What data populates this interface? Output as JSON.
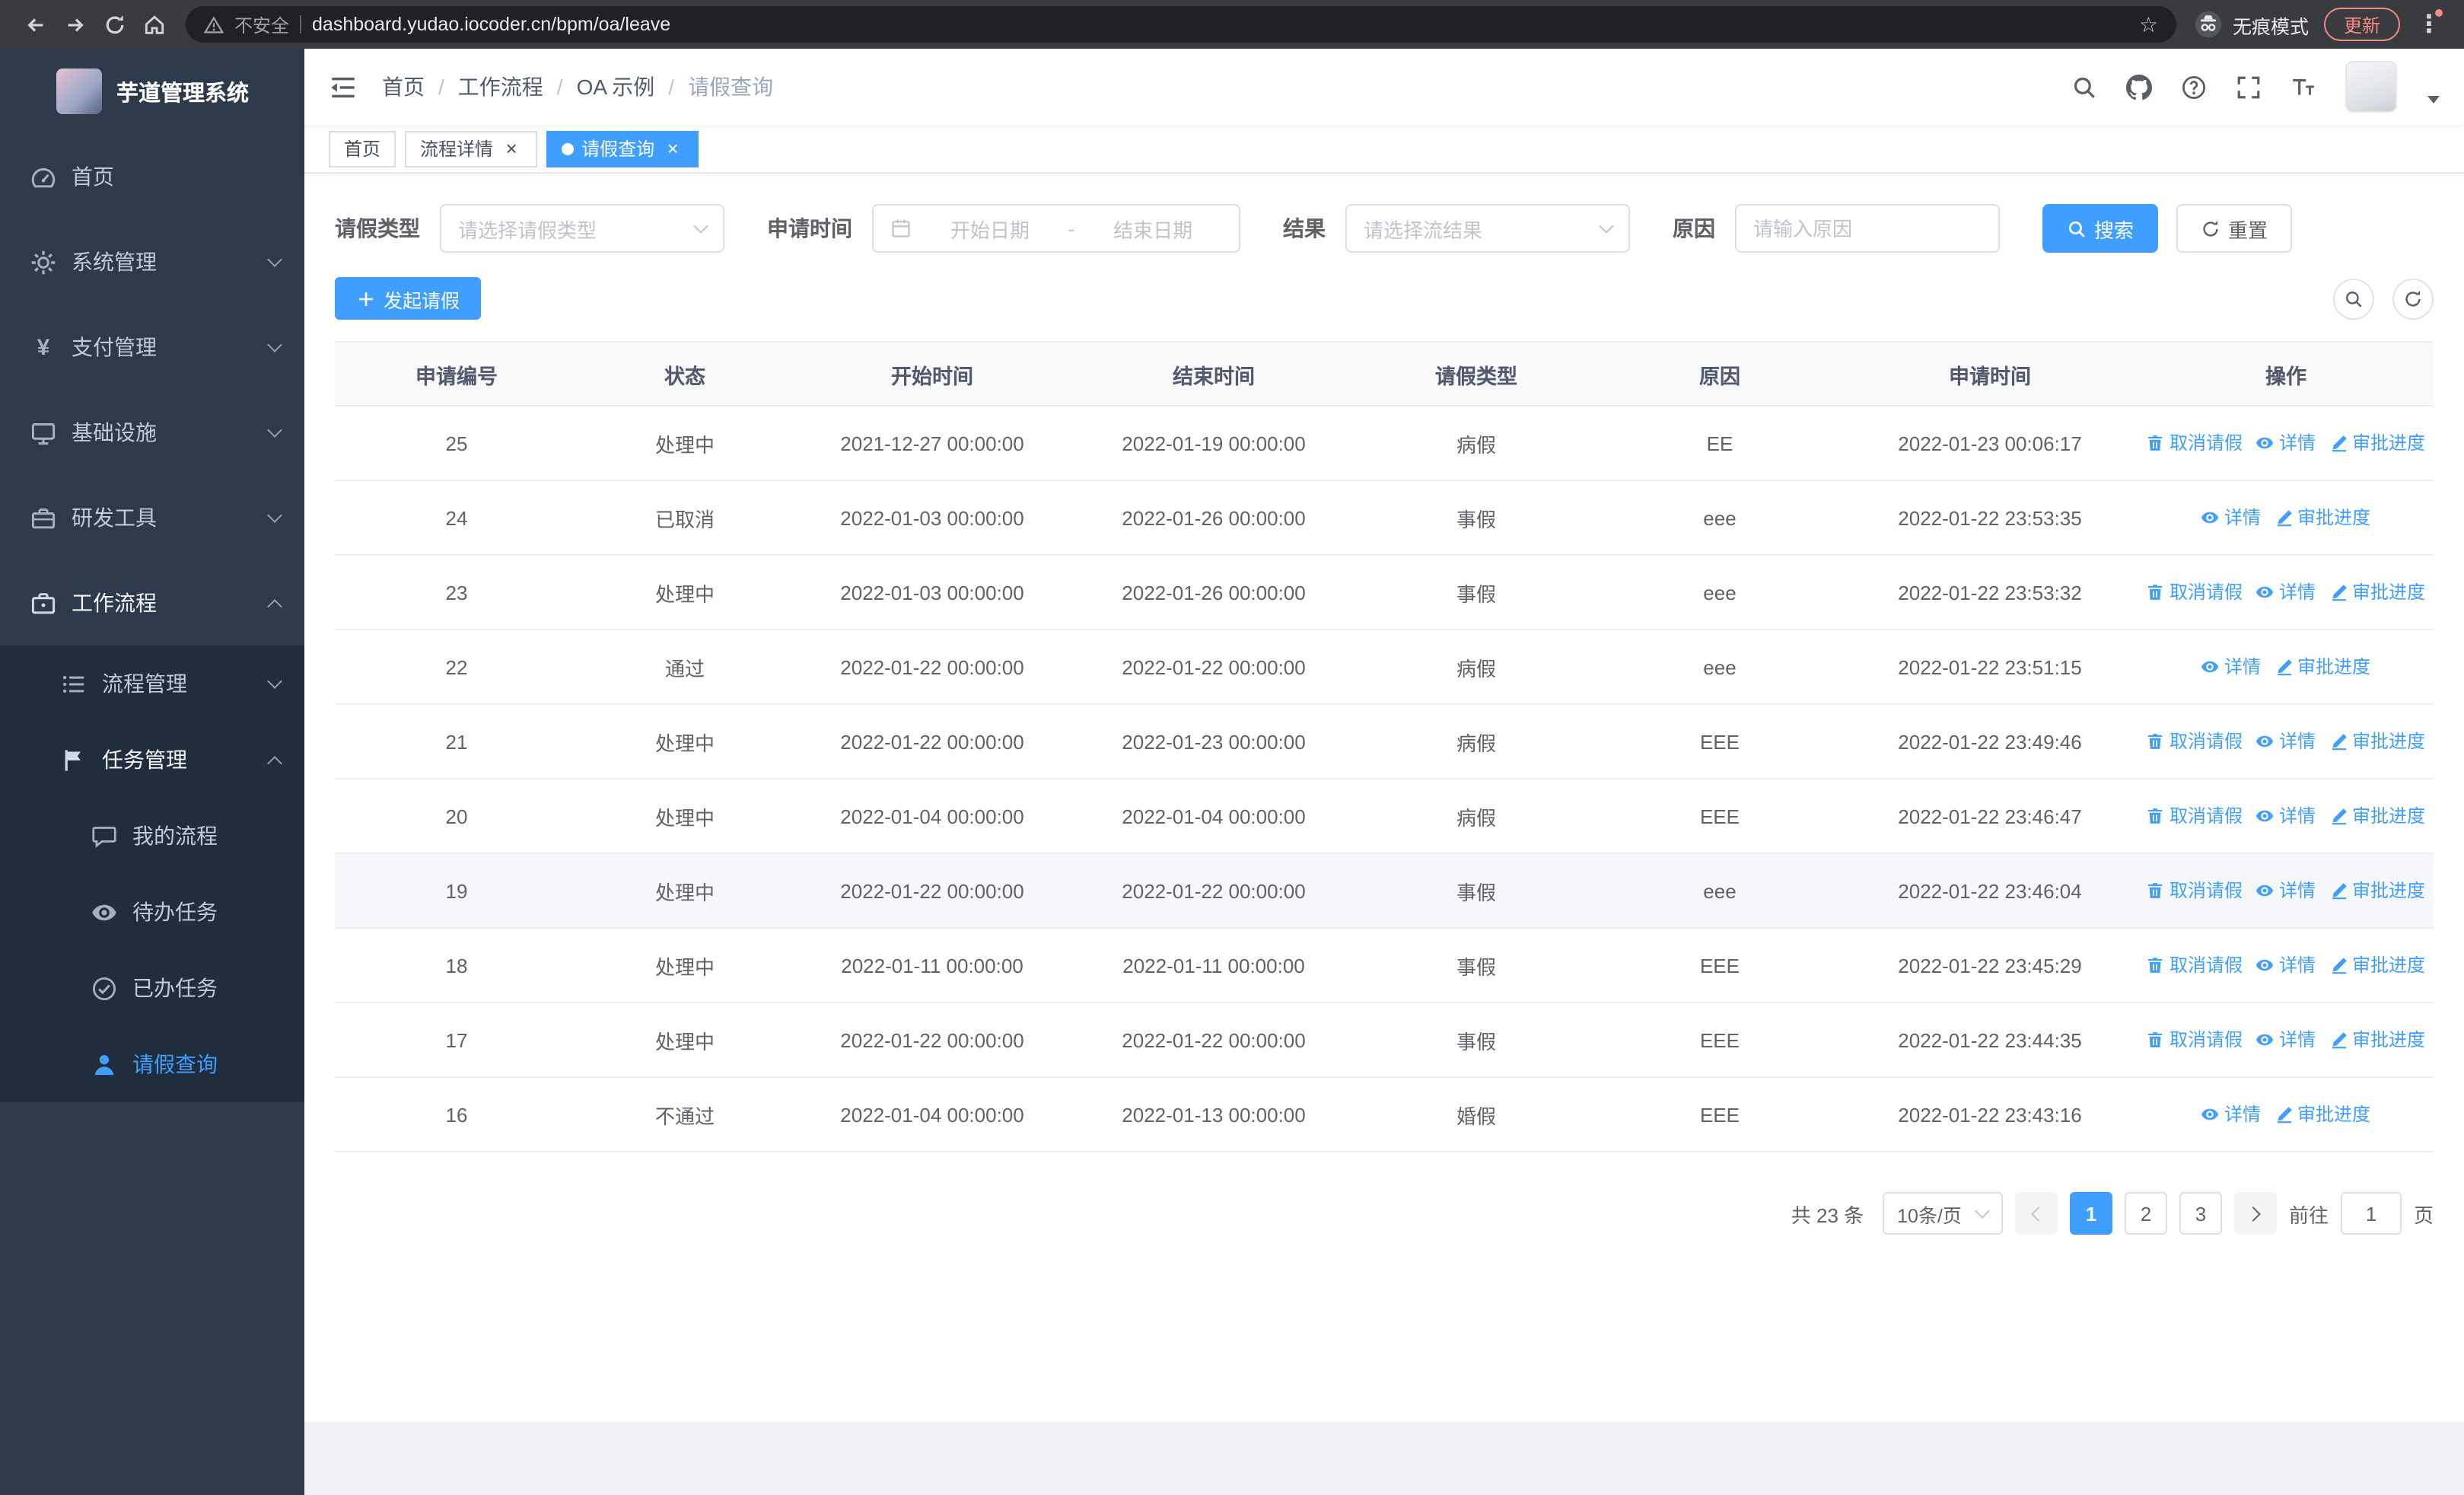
{
  "colors": {
    "accent": "#409eff",
    "sidebar_bg": "#2d3a4b",
    "sidebar_submenu_bg": "#1f2d3d",
    "table_header_bg": "#f8f8f9",
    "link": "#409eff"
  },
  "browser": {
    "security_warning": "不安全",
    "url": "dashboard.yudao.iocoder.cn/bpm/oa/leave",
    "incognito_label": "无痕模式",
    "update_label": "更新"
  },
  "sidebar": {
    "logo_title": "芋道管理系统",
    "home": "首页",
    "system": "系统管理",
    "payment": "支付管理",
    "infra": "基础设施",
    "devtools": "研发工具",
    "workflow": "工作流程",
    "process_mgmt": "流程管理",
    "task_mgmt": "任务管理",
    "my_process": "我的流程",
    "todo_tasks": "待办任务",
    "done_tasks": "已办任务",
    "leave_query": "请假查询",
    "yen_glyph": "¥"
  },
  "breadcrumb": {
    "items": [
      "首页",
      "工作流程",
      "OA 示例",
      "请假查询"
    ],
    "separator": "/"
  },
  "tabs": [
    {
      "label": "首页",
      "closable": false,
      "active": false
    },
    {
      "label": "流程详情",
      "closable": true,
      "active": false
    },
    {
      "label": "请假查询",
      "closable": true,
      "active": true
    }
  ],
  "close_glyph": "×",
  "filters": {
    "leave_type_label": "请假类型",
    "leave_type_placeholder": "请选择请假类型",
    "apply_time_label": "申请时间",
    "start_date_placeholder": "开始日期",
    "range_separator": "-",
    "end_date_placeholder": "结束日期",
    "result_label": "结果",
    "result_placeholder": "请选择流结果",
    "reason_label": "原因",
    "reason_placeholder": "请输入原因",
    "search_label": "搜索",
    "reset_label": "重置"
  },
  "toolbar": {
    "create_label": "发起请假"
  },
  "table": {
    "columns": [
      "申请编号",
      "状态",
      "开始时间",
      "结束时间",
      "请假类型",
      "原因",
      "申请时间",
      "操作"
    ],
    "ops_labels": {
      "cancel": "取消请假",
      "detail": "详情",
      "progress": "审批进度"
    },
    "rows": [
      {
        "id": "25",
        "status": "处理中",
        "start": "2021-12-27 00:00:00",
        "end": "2022-01-19 00:00:00",
        "type": "病假",
        "reason": "EE",
        "applied": "2022-01-23 00:06:17",
        "ops": [
          "cancel",
          "detail",
          "progress"
        ],
        "highlighted": false
      },
      {
        "id": "24",
        "status": "已取消",
        "start": "2022-01-03 00:00:00",
        "end": "2022-01-26 00:00:00",
        "type": "事假",
        "reason": "eee",
        "applied": "2022-01-22 23:53:35",
        "ops": [
          "detail",
          "progress"
        ],
        "highlighted": false
      },
      {
        "id": "23",
        "status": "处理中",
        "start": "2022-01-03 00:00:00",
        "end": "2022-01-26 00:00:00",
        "type": "事假",
        "reason": "eee",
        "applied": "2022-01-22 23:53:32",
        "ops": [
          "cancel",
          "detail",
          "progress"
        ],
        "highlighted": false
      },
      {
        "id": "22",
        "status": "通过",
        "start": "2022-01-22 00:00:00",
        "end": "2022-01-22 00:00:00",
        "type": "病假",
        "reason": "eee",
        "applied": "2022-01-22 23:51:15",
        "ops": [
          "detail",
          "progress"
        ],
        "highlighted": false
      },
      {
        "id": "21",
        "status": "处理中",
        "start": "2022-01-22 00:00:00",
        "end": "2022-01-23 00:00:00",
        "type": "病假",
        "reason": "EEE",
        "applied": "2022-01-22 23:49:46",
        "ops": [
          "cancel",
          "detail",
          "progress"
        ],
        "highlighted": false
      },
      {
        "id": "20",
        "status": "处理中",
        "start": "2022-01-04 00:00:00",
        "end": "2022-01-04 00:00:00",
        "type": "病假",
        "reason": "EEE",
        "applied": "2022-01-22 23:46:47",
        "ops": [
          "cancel",
          "detail",
          "progress"
        ],
        "highlighted": false
      },
      {
        "id": "19",
        "status": "处理中",
        "start": "2022-01-22 00:00:00",
        "end": "2022-01-22 00:00:00",
        "type": "事假",
        "reason": "eee",
        "applied": "2022-01-22 23:46:04",
        "ops": [
          "cancel",
          "detail",
          "progress"
        ],
        "highlighted": true
      },
      {
        "id": "18",
        "status": "处理中",
        "start": "2022-01-11 00:00:00",
        "end": "2022-01-11 00:00:00",
        "type": "事假",
        "reason": "EEE",
        "applied": "2022-01-22 23:45:29",
        "ops": [
          "cancel",
          "detail",
          "progress"
        ],
        "highlighted": false
      },
      {
        "id": "17",
        "status": "处理中",
        "start": "2022-01-22 00:00:00",
        "end": "2022-01-22 00:00:00",
        "type": "事假",
        "reason": "EEE",
        "applied": "2022-01-22 23:44:35",
        "ops": [
          "cancel",
          "detail",
          "progress"
        ],
        "highlighted": false
      },
      {
        "id": "16",
        "status": "不通过",
        "start": "2022-01-04 00:00:00",
        "end": "2022-01-13 00:00:00",
        "type": "婚假",
        "reason": "EEE",
        "applied": "2022-01-22 23:43:16",
        "ops": [
          "detail",
          "progress"
        ],
        "highlighted": false
      }
    ]
  },
  "pagination": {
    "total_text": "共 23 条",
    "page_size": "10条/页",
    "pages": [
      "1",
      "2",
      "3"
    ],
    "active_page": "1",
    "goto_label": "前往",
    "goto_value": "1",
    "goto_unit": "页"
  }
}
